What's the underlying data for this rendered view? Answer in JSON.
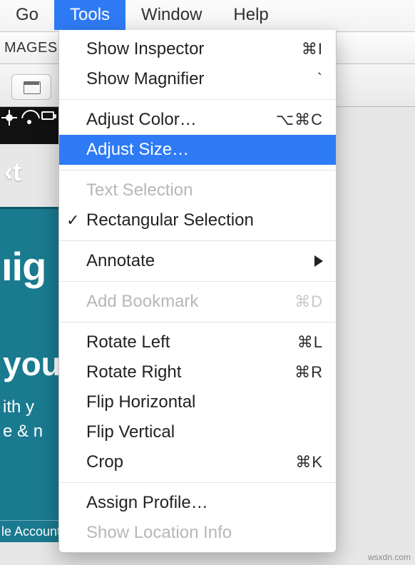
{
  "menubar": {
    "items": [
      {
        "label": "Go",
        "active": false
      },
      {
        "label": "Tools",
        "active": true
      },
      {
        "label": "Window",
        "active": false
      },
      {
        "label": "Help",
        "active": false
      }
    ]
  },
  "tabbar": {
    "title": "MAGES"
  },
  "dropdown": {
    "groups": [
      [
        {
          "label": "Show Inspector",
          "shortcut": "⌘I",
          "disabled": false
        },
        {
          "label": "Show Magnifier",
          "shortcut": "`",
          "disabled": false
        }
      ],
      [
        {
          "label": "Adjust Color…",
          "shortcut": "⌥⌘C",
          "disabled": false
        },
        {
          "label": "Adjust Size…",
          "shortcut": "",
          "disabled": false,
          "highlight": true
        }
      ],
      [
        {
          "label": "Text Selection",
          "shortcut": "",
          "disabled": true
        },
        {
          "label": "Rectangular Selection",
          "shortcut": "",
          "disabled": false,
          "checked": true
        }
      ],
      [
        {
          "label": "Annotate",
          "shortcut": "",
          "disabled": false,
          "submenu": true
        }
      ],
      [
        {
          "label": "Add Bookmark",
          "shortcut": "⌘D",
          "disabled": true
        }
      ],
      [
        {
          "label": "Rotate Left",
          "shortcut": "⌘L",
          "disabled": false
        },
        {
          "label": "Rotate Right",
          "shortcut": "⌘R",
          "disabled": false
        },
        {
          "label": "Flip Horizontal",
          "shortcut": "",
          "disabled": false
        },
        {
          "label": "Flip Vertical",
          "shortcut": "",
          "disabled": false
        },
        {
          "label": "Crop",
          "shortcut": "⌘K",
          "disabled": false
        }
      ],
      [
        {
          "label": "Assign Profile…",
          "shortcut": "",
          "disabled": false
        },
        {
          "label": "Show Location Info",
          "shortcut": "",
          "disabled": true
        }
      ]
    ]
  },
  "background": {
    "xt": "‹t",
    "big1": "ıig",
    "big2": "you",
    "line1": "ith y",
    "line2": "e & n",
    "line3": "le Account to use"
  },
  "watermark": "wsxdn.com"
}
